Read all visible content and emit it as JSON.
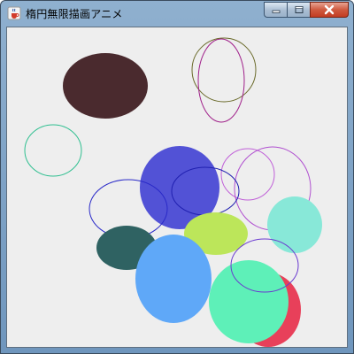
{
  "window": {
    "title": "楕円無限描画アニメ",
    "app_icon": "java-coffee-cup-icon",
    "controls": [
      "minimize-icon",
      "maximize-icon",
      "close-icon"
    ]
  },
  "canvas": {
    "background": "#eeeeee",
    "ellipses": [
      {
        "id": "dark-maroon-filled",
        "filled": true,
        "color": "#4a2a2e"
      },
      {
        "id": "olive-outline",
        "filled": false,
        "color": "#6a6a2a"
      },
      {
        "id": "purple-outline-tall",
        "filled": false,
        "color": "#a0208a"
      },
      {
        "id": "teal-outline",
        "filled": false,
        "color": "#2fbf90"
      },
      {
        "id": "violet-outline-1",
        "filled": false,
        "color": "#c060d8"
      },
      {
        "id": "violet-outline-2",
        "filled": false,
        "color": "#b050d0"
      },
      {
        "id": "royal-blue-filled",
        "filled": true,
        "color": "#5252d6"
      },
      {
        "id": "navy-outline-1",
        "filled": false,
        "color": "#2a2ac8"
      },
      {
        "id": "navy-outline-2",
        "filled": false,
        "color": "#2020b0"
      },
      {
        "id": "mint-filled",
        "filled": true,
        "color": "#88e8d8"
      },
      {
        "id": "lime-filled",
        "filled": true,
        "color": "#bce65a"
      },
      {
        "id": "slate-green-filled",
        "filled": true,
        "color": "#2f6262"
      },
      {
        "id": "sky-blue-filled",
        "filled": true,
        "color": "#5fa8f8"
      },
      {
        "id": "crimson-filled",
        "filled": true,
        "color": "#e8405a"
      },
      {
        "id": "spring-green-filled",
        "filled": true,
        "color": "#5ef0b8"
      },
      {
        "id": "indigo-outline",
        "filled": false,
        "color": "#6a3ad0"
      }
    ]
  }
}
